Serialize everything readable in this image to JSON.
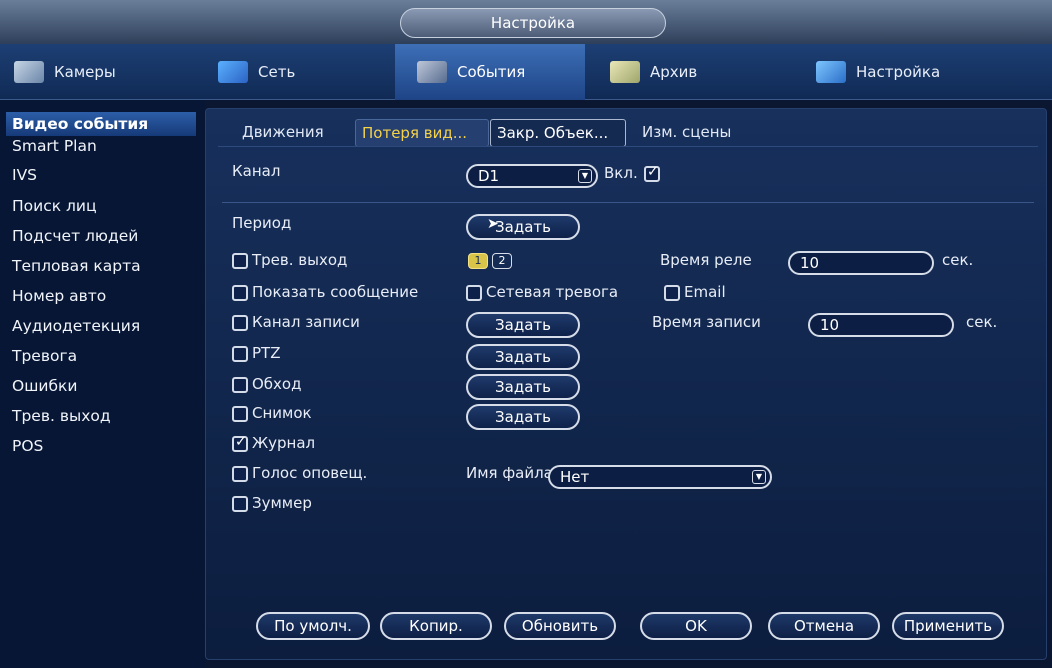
{
  "window": {
    "title": "Настройка"
  },
  "main_tabs": [
    {
      "label": "Камеры",
      "icon": "camera-icon"
    },
    {
      "label": "Сеть",
      "icon": "network-icon"
    },
    {
      "label": "События",
      "icon": "events-icon"
    },
    {
      "label": "Архив",
      "icon": "storage-icon"
    },
    {
      "label": "Настройка",
      "icon": "system-icon"
    }
  ],
  "sidebar": {
    "items": [
      {
        "label": "Видео события"
      },
      {
        "label": "Smart Plan"
      },
      {
        "label": "IVS"
      },
      {
        "label": "Поиск лиц"
      },
      {
        "label": "Подсчет людей"
      },
      {
        "label": "Тепловая карта"
      },
      {
        "label": "Номер авто"
      },
      {
        "label": "Аудиодетекция"
      },
      {
        "label": "Тревога"
      },
      {
        "label": "Ошибки"
      },
      {
        "label": "Трев. выход"
      },
      {
        "label": "POS"
      }
    ]
  },
  "sub_tabs": [
    {
      "label": "Движения"
    },
    {
      "label": "Потеря вид..."
    },
    {
      "label": "Закр. Объек..."
    },
    {
      "label": "Изм. сцены"
    }
  ],
  "form": {
    "channel_label": "Канал",
    "channel_value": "D1",
    "enable_label": "Вкл.",
    "enable_checked": true,
    "period_label": "Период",
    "set_label": "Задать",
    "alarm_out_label": "Трев. выход",
    "alarm_out_values": [
      "1",
      "2"
    ],
    "relay_time_label": "Время реле",
    "relay_time_value": "10",
    "sec_label": "сек.",
    "show_message_label": "Показать сообщение",
    "net_alarm_label": "Сетевая тревога",
    "email_label": "Email",
    "record_channel_label": "Канал записи",
    "record_time_label": "Время записи",
    "record_time_value": "10",
    "ptz_label": "PTZ",
    "tour_label": "Обход",
    "snapshot_label": "Снимок",
    "log_label": "Журнал",
    "voice_label": "Голос оповещ.",
    "file_name_label": "Имя файла",
    "file_name_value": "Нет",
    "buzzer_label": "Зуммер"
  },
  "footer": {
    "default_label": "По умолч.",
    "copy_label": "Копир.",
    "refresh_label": "Обновить",
    "ok_label": "OK",
    "cancel_label": "Отмена",
    "apply_label": "Применить"
  },
  "colors": {
    "accent_active_tab": "#f5d24a",
    "panel_bg": "#17305c",
    "alarm_out_active": "#d9c44a"
  }
}
